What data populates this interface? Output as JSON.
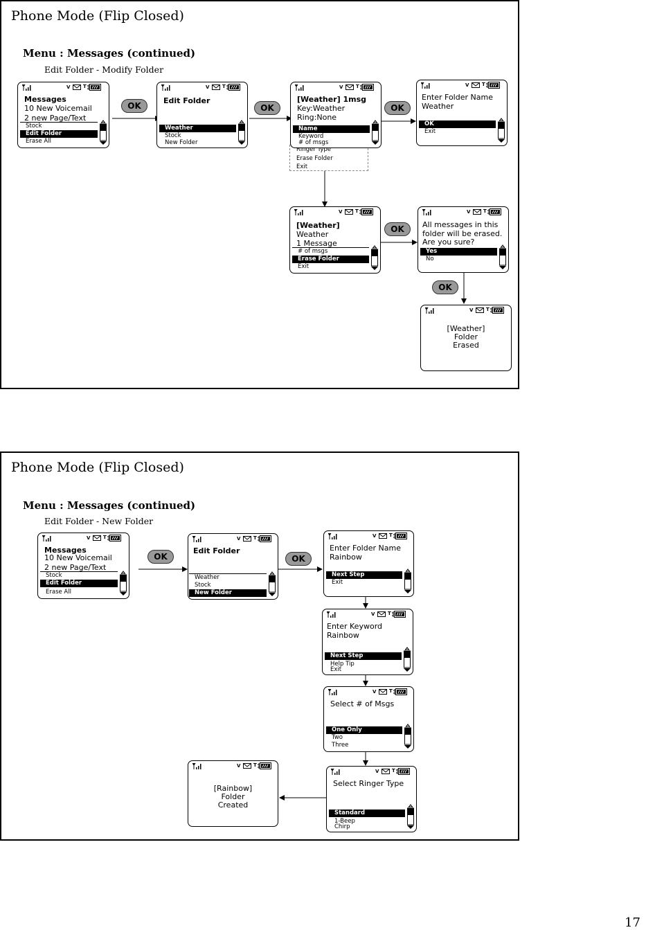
{
  "page_number": "17",
  "status_icons": {
    "signal": "signal-strength-icon",
    "voicemail": "V",
    "message": "envelope-icon",
    "tty": "T",
    "battery": "battery-icon"
  },
  "ok_label": "OK",
  "panels": [
    {
      "title": "Phone Mode (Flip Closed)",
      "subtitle": "Menu : Messages (continued)",
      "section": "Edit Folder - Modify Folder",
      "screens": {
        "messages": {
          "header_bold": "Messages",
          "header_lines": [
            "10 New Voicemail",
            "2 new Page/Text"
          ],
          "items": [
            "Stock",
            "Edit Folder",
            "Erase All"
          ],
          "selected": "Edit Folder"
        },
        "edit_folder": {
          "header_bold": "Edit Folder",
          "items": [
            "Weather",
            "Stock",
            "New Folder"
          ],
          "selected": "Weather"
        },
        "weather_detail": {
          "header_bold": "[Weather] 1msg",
          "header_lines": [
            "Key:Weather",
            "Ring:None"
          ],
          "items": [
            "Name",
            "Keyword",
            "# of msgs"
          ],
          "selected": "Name",
          "overflow_items": [
            "Ringer Type",
            "Erase Folder",
            "Exit"
          ]
        },
        "enter_name": {
          "header_lines": [
            "Enter Folder Name",
            "Weather"
          ],
          "items": [
            "OK",
            "Exit"
          ],
          "selected": "OK"
        },
        "weather_erase": {
          "header_bold": "[Weather]",
          "header_lines": [
            "Weather",
            "1 Message"
          ],
          "items": [
            "# of msgs",
            "Erase Folder",
            "Exit"
          ],
          "selected": "Erase Folder"
        },
        "confirm": {
          "header_lines": [
            "All messages in this",
            "folder will be erased.",
            "Are you sure?"
          ],
          "items": [
            "Yes",
            "No"
          ],
          "selected": "Yes"
        },
        "erased": {
          "lines": [
            "[Weather]",
            "Folder",
            "Erased"
          ]
        }
      }
    },
    {
      "title": "Phone Mode (Flip Closed)",
      "subtitle": "Menu : Messages (continued)",
      "section": "Edit Folder - New Folder",
      "screens": {
        "messages": {
          "header_bold": "Messages",
          "header_lines": [
            "10 New Voicemail",
            "2 new Page/Text"
          ],
          "items": [
            "Stock",
            "Edit Folder",
            "Erase All"
          ],
          "selected": "Edit Folder"
        },
        "edit_folder": {
          "header_bold": "Edit Folder",
          "items": [
            "Weather",
            "Stock",
            "New Folder"
          ],
          "selected": "New Folder"
        },
        "enter_name": {
          "header_lines": [
            "Enter Folder Name",
            "Rainbow"
          ],
          "items": [
            "Next Step",
            "Exit"
          ],
          "selected": "Next Step"
        },
        "enter_keyword": {
          "header_lines": [
            "Enter Keyword",
            "Rainbow"
          ],
          "items": [
            "Next Step",
            "Help Tip",
            "Exit"
          ],
          "selected": "Next Step"
        },
        "select_msgs": {
          "header_lines": [
            "Select # of Msgs"
          ],
          "items": [
            "One Only",
            "Two",
            "Three"
          ],
          "selected": "One Only"
        },
        "select_ringer": {
          "header_lines": [
            "Select Ringer Type"
          ],
          "items": [
            "Standard",
            "1-Beep",
            "Chirp"
          ],
          "selected": "Standard"
        },
        "created": {
          "lines": [
            "[Rainbow]",
            "Folder",
            "Created"
          ]
        }
      }
    }
  ]
}
